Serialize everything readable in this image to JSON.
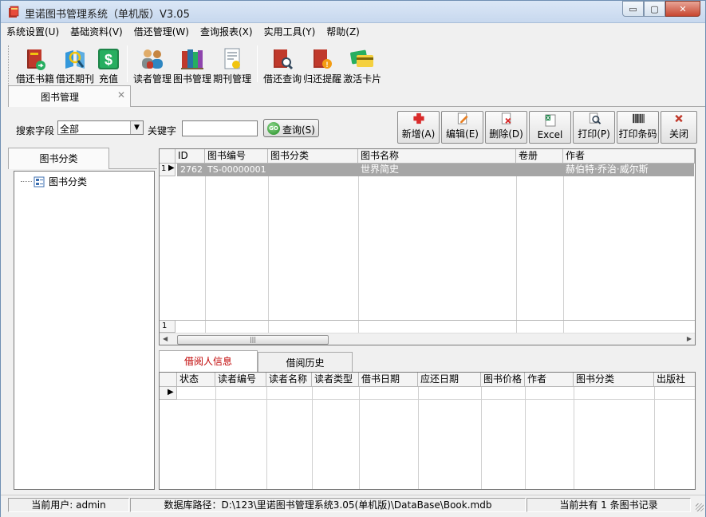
{
  "window": {
    "title": "里诺图书管理系统（单机版）V3.05",
    "buttons": {
      "minimize": "▭",
      "maximize": "▢",
      "close": "✕"
    }
  },
  "menu": [
    "系统设置(U)",
    "基础资料(V)",
    "借还管理(W)",
    "查询报表(X)",
    "实用工具(Y)",
    "帮助(Z)"
  ],
  "toolbar": {
    "groups": [
      [
        {
          "label": "借还书籍",
          "icon": "book-borrow-icon"
        },
        {
          "label": "借还期刊",
          "icon": "journal-borrow-icon"
        },
        {
          "label": "充值",
          "icon": "dollar-icon"
        }
      ],
      [
        {
          "label": "读者管理",
          "icon": "readers-icon"
        },
        {
          "label": "图书管理",
          "icon": "books-icon"
        },
        {
          "label": "期刊管理",
          "icon": "journal-icon"
        }
      ],
      [
        {
          "label": "借还查询",
          "icon": "search-book-icon"
        },
        {
          "label": "归还提醒",
          "icon": "reminder-icon"
        },
        {
          "label": "激活卡片",
          "icon": "card-icon"
        }
      ]
    ]
  },
  "doc_tab": {
    "label": "图书管理",
    "close": "✕"
  },
  "search": {
    "field_label": "搜索字段",
    "field_value": "全部",
    "keyword_label": "关键字",
    "keyword_value": "",
    "query_label": "查询(S)",
    "go_badge": "GO"
  },
  "actions": [
    {
      "label": "新增(A)",
      "icon": "add-icon"
    },
    {
      "label": "编辑(E)",
      "icon": "edit-icon"
    },
    {
      "label": "删除(D)",
      "icon": "delete-icon"
    },
    {
      "label": "Excel",
      "icon": "excel-icon"
    },
    {
      "label": "打印(P)",
      "icon": "print-icon"
    },
    {
      "label": "打印条码",
      "icon": "barcode-icon"
    },
    {
      "label": "关闭",
      "icon": "close-icon"
    }
  ],
  "left_panel": {
    "tab": "图书分类",
    "tree": [
      {
        "label": "图书分类",
        "icon": "category-icon"
      }
    ]
  },
  "book_grid": {
    "columns": [
      "ID",
      "图书编号",
      "图书分类",
      "图书名称",
      "卷册",
      "作者"
    ],
    "rows": [
      {
        "indicator": "1",
        "id": "2762",
        "code": "TS-00000001",
        "category": "",
        "name": "世界简史",
        "volume": "",
        "author": "赫伯特·乔治·威尔斯"
      }
    ],
    "footer_indicator": "1"
  },
  "sub_tabs": [
    "借阅人信息",
    "借阅历史"
  ],
  "borrow_grid": {
    "columns": [
      "状态",
      "读者编号",
      "读者名称",
      "读者类型",
      "借书日期",
      "应还日期",
      "图书价格",
      "作者",
      "图书分类",
      "出版社"
    ]
  },
  "status": {
    "user": "当前用户: admin",
    "db_path": "数据库路径：D:\\123\\里诺图书管理系统3.05(单机版)\\DataBase\\Book.mdb",
    "records": "当前共有 1 条图书记录"
  },
  "colors": {
    "accent_tab": "#c00000",
    "selected_row": "#a6a6a6",
    "title_bg": "#c7d8ee"
  }
}
